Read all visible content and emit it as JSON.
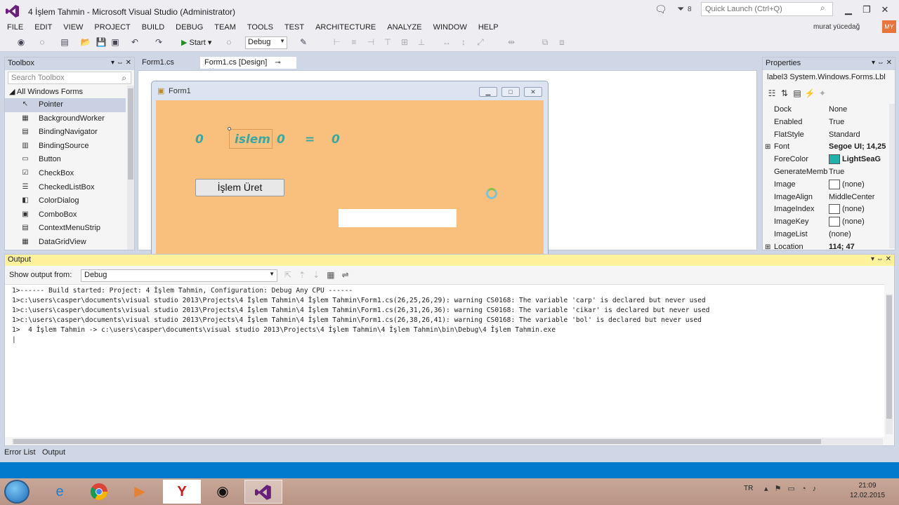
{
  "window": {
    "title": "4 İşlem Tahmin - Microsoft Visual Studio (Administrator)",
    "notification_count": "8",
    "quick_launch_placeholder": "Quick Launch (Ctrl+Q)",
    "user": "murat yücedağ",
    "avatar_initials": "MY"
  },
  "menu": [
    "FILE",
    "EDIT",
    "VIEW",
    "PROJECT",
    "BUILD",
    "DEBUG",
    "TEAM",
    "TOOLS",
    "TEST",
    "ARCHITECTURE",
    "ANALYZE",
    "WINDOW",
    "HELP"
  ],
  "toolbar": {
    "start_label": "Start",
    "config": "Debug"
  },
  "toolbox": {
    "title": "Toolbox",
    "search_placeholder": "Search Toolbox",
    "section": "All Windows Forms",
    "items": [
      {
        "label": "Pointer",
        "icon": "pointer-icon",
        "glyph": "↖",
        "selected": true
      },
      {
        "label": "BackgroundWorker",
        "icon": "background-worker-icon",
        "glyph": "▦"
      },
      {
        "label": "BindingNavigator",
        "icon": "binding-navigator-icon",
        "glyph": "▤"
      },
      {
        "label": "BindingSource",
        "icon": "binding-source-icon",
        "glyph": "▥"
      },
      {
        "label": "Button",
        "icon": "button-icon",
        "glyph": "▭"
      },
      {
        "label": "CheckBox",
        "icon": "checkbox-icon",
        "glyph": "☑"
      },
      {
        "label": "CheckedListBox",
        "icon": "checked-list-box-icon",
        "glyph": "☰"
      },
      {
        "label": "ColorDialog",
        "icon": "color-dialog-icon",
        "glyph": "◧"
      },
      {
        "label": "ComboBox",
        "icon": "combo-box-icon",
        "glyph": "▣"
      },
      {
        "label": "ContextMenuStrip",
        "icon": "context-menu-strip-icon",
        "glyph": "▤"
      },
      {
        "label": "DataGridView",
        "icon": "data-grid-view-icon",
        "glyph": "▦"
      }
    ]
  },
  "tabs": [
    {
      "label": "Form1.cs"
    },
    {
      "label": "Form1.cs [Design]"
    }
  ],
  "form": {
    "title": "Form1",
    "labels": {
      "left": "0",
      "op": "islem",
      "right": "0",
      "eq": "=",
      "result": "0"
    },
    "button": "İşlem Üret"
  },
  "properties": {
    "title": "Properties",
    "object": "label3  System.Windows.Forms.Lbl",
    "rows": [
      {
        "name": "Dock",
        "value": "None"
      },
      {
        "name": "Enabled",
        "value": "True"
      },
      {
        "name": "FlatStyle",
        "value": "Standard"
      },
      {
        "name": "Font",
        "value": "Segoe UI; 14,25",
        "expand": "⊞",
        "bold": true
      },
      {
        "name": "ForeColor",
        "value": "LightSeaG",
        "swatch": "#20b2aa",
        "bold": true
      },
      {
        "name": "GenerateMemb",
        "value": "True"
      },
      {
        "name": "Image",
        "value": "(none)",
        "swatch": "#ffffff"
      },
      {
        "name": "ImageAlign",
        "value": "MiddleCenter"
      },
      {
        "name": "ImageIndex",
        "value": "(none)",
        "swatch": "#ffffff"
      },
      {
        "name": "ImageKey",
        "value": "(none)",
        "swatch": "#ffffff"
      },
      {
        "name": "ImageList",
        "value": "(none)"
      },
      {
        "name": "Location",
        "value": "114; 47",
        "expand": "⊞",
        "bold": true
      }
    ]
  },
  "output": {
    "title": "Output",
    "show_from_label": "Show output from:",
    "source": "Debug",
    "lines": [
      "1>------ Build started: Project: 4 İşlem Tahmin, Configuration: Debug Any CPU ------",
      "1>c:\\users\\casper\\documents\\visual studio 2013\\Projects\\4 İşlem Tahmin\\4 İşlem Tahmin\\Form1.cs(26,25,26,29): warning CS0168: The variable 'carp' is declared but never used",
      "1>c:\\users\\casper\\documents\\visual studio 2013\\Projects\\4 İşlem Tahmin\\4 İşlem Tahmin\\Form1.cs(26,31,26,36): warning CS0168: The variable 'cikar' is declared but never used",
      "1>c:\\users\\casper\\documents\\visual studio 2013\\Projects\\4 İşlem Tahmin\\4 İşlem Tahmin\\Form1.cs(26,38,26,41): warning CS0168: The variable 'bol' is declared but never used",
      "1>  4 İşlem Tahmin -> c:\\users\\casper\\documents\\visual studio 2013\\Projects\\4 İşlem Tahmin\\4 İşlem Tahmin\\bin\\Debug\\4 İşlem Tahmin.exe",
      "|"
    ]
  },
  "bottom_tabs": [
    "Error List",
    "Output"
  ],
  "taskbar": {
    "language": "TR",
    "time": "21:09",
    "date": "12.02.2015"
  }
}
